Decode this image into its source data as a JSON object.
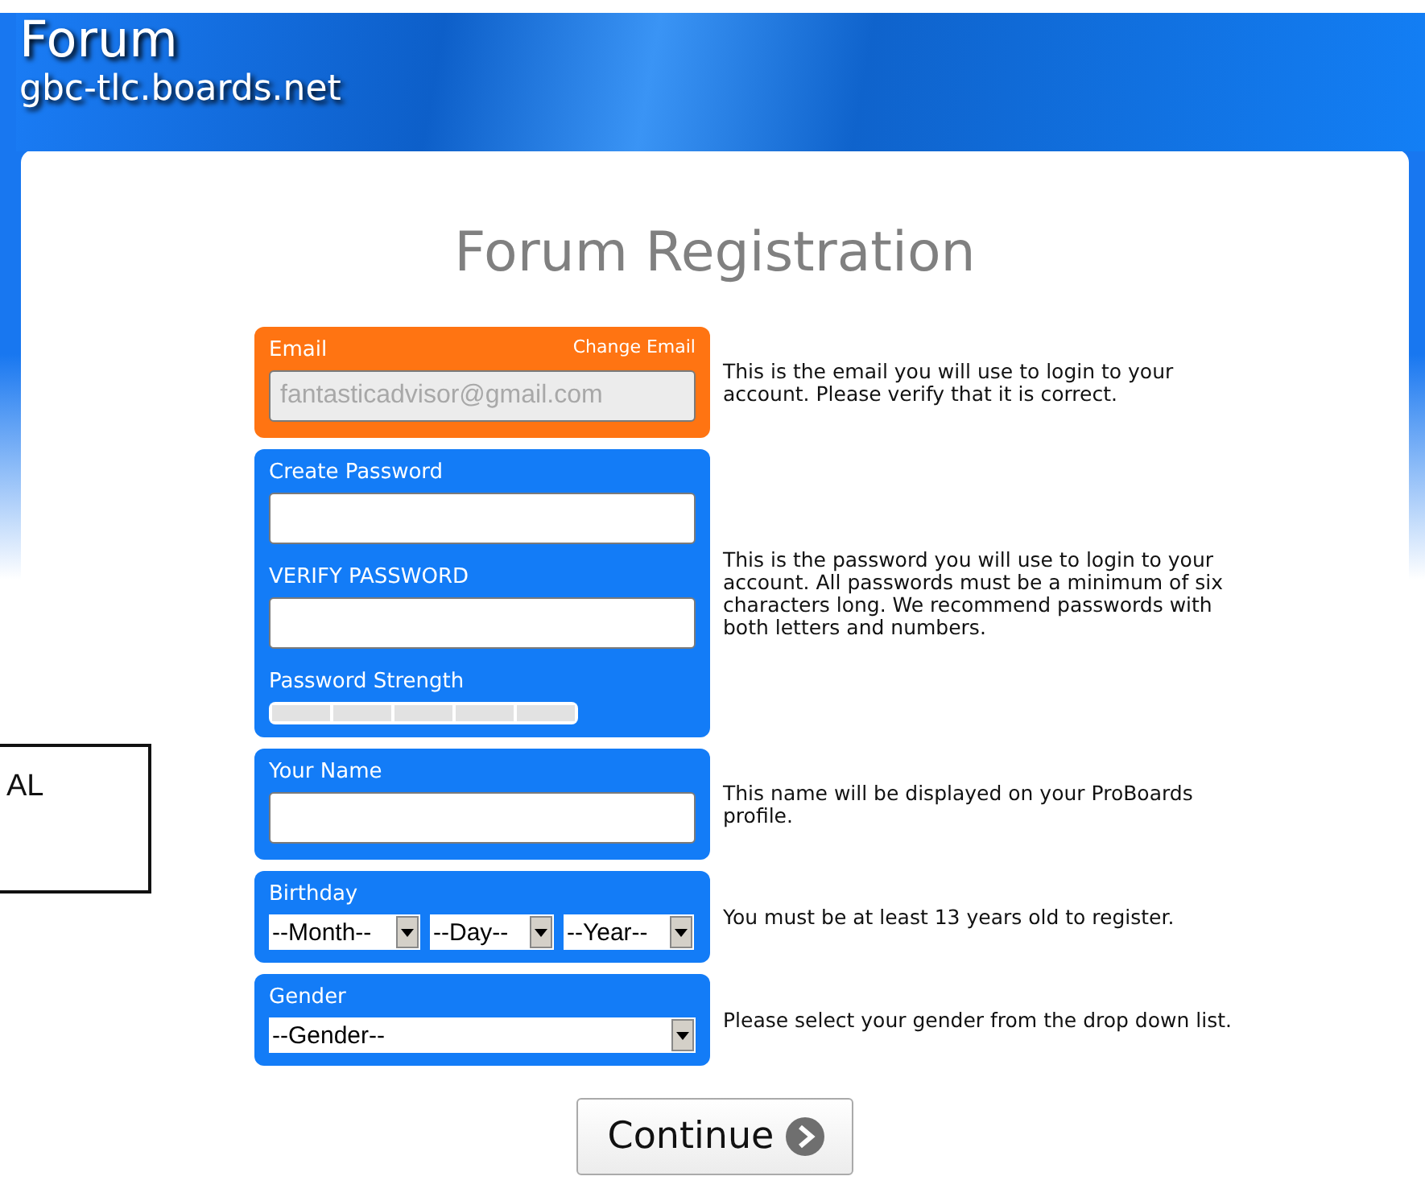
{
  "header": {
    "title": "Forum",
    "subtitle": "gbc-tlc.boards.net"
  },
  "page_title": "Forum Registration",
  "sections": [
    {
      "kind": "email",
      "label": "Email",
      "link": "Change Email",
      "value": "fantasticadvisor@gmail.com",
      "disabled": true,
      "help": "This is the email you will use to login to your account. Please verify that it is correct."
    },
    {
      "kind": "password",
      "fields": [
        {
          "label": "Create Password"
        },
        {
          "label": "VERIFY PASSWORD"
        }
      ],
      "strength": {
        "label": "Password Strength"
      },
      "help": "This is the password you will use to login to your account. All passwords must be a minimum of six characters long. We recommend passwords with both letters and numbers."
    },
    {
      "kind": "text",
      "label": "Your Name",
      "help": "This name will be displayed on your ProBoards profile."
    },
    {
      "kind": "birthday",
      "label": "Birthday",
      "selects": [
        "--Month--",
        "--Day--",
        "--Year--"
      ],
      "help": "You must be at least 13 years old to register."
    },
    {
      "kind": "gender",
      "label": "Gender",
      "selects": [
        "--Gender--"
      ],
      "help": "Please select your gender from the drop down list."
    }
  ],
  "continue_button": "Continue",
  "callout": {
    "text": "AL"
  }
}
